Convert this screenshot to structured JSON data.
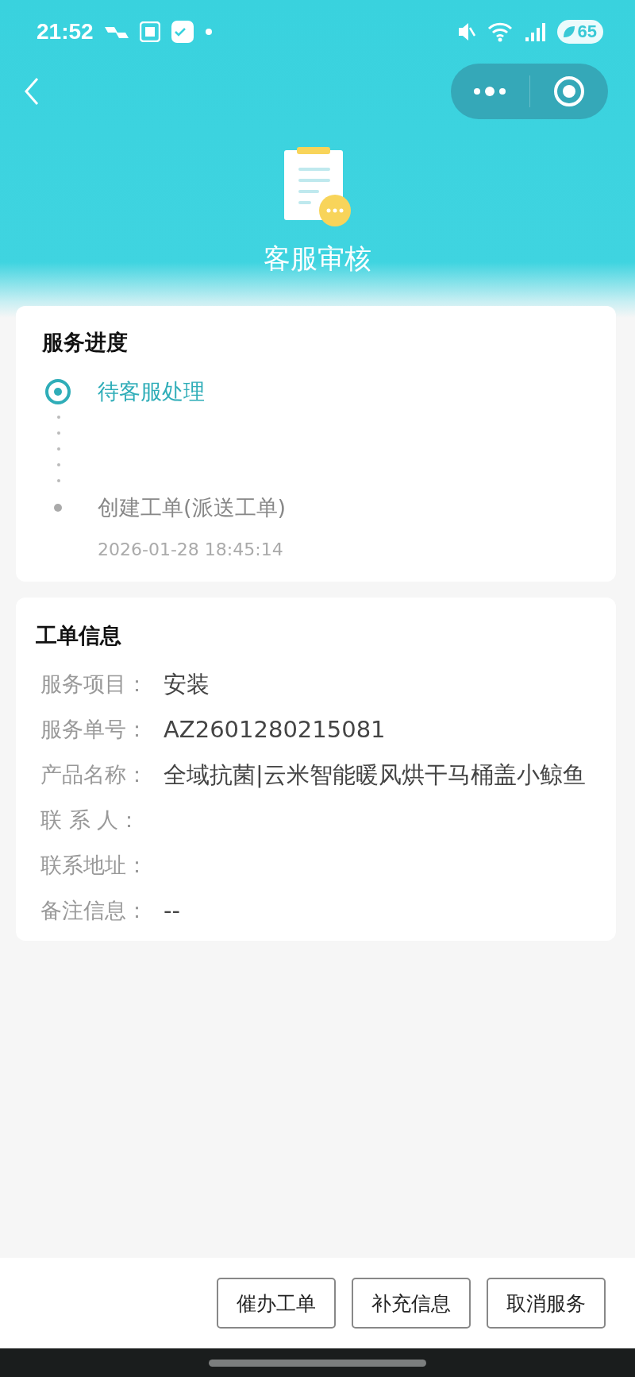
{
  "status_bar": {
    "time": "21:52",
    "battery": "65"
  },
  "header": {
    "title": "客服审核"
  },
  "progress": {
    "title": "服务进度",
    "steps": [
      {
        "label": "待客服处理",
        "current": true
      },
      {
        "label": "创建工单(派送工单)",
        "current": false,
        "time": "2026-01-28 18:45:14"
      }
    ]
  },
  "order_info": {
    "title": "工单信息",
    "rows": [
      {
        "label": "服务项目：",
        "value": "安装"
      },
      {
        "label": "服务单号：",
        "value": "AZ2601280215081"
      },
      {
        "label": "产品名称：",
        "value": "全域抗菌|云米智能暖风烘干马桶盖小鲸鱼"
      },
      {
        "label": "联 系 人："
      },
      {
        "label": "联系地址："
      },
      {
        "label": "备注信息：",
        "value": "--"
      }
    ]
  },
  "buttons": [
    "催办工单",
    "补充信息",
    "取消服务"
  ]
}
